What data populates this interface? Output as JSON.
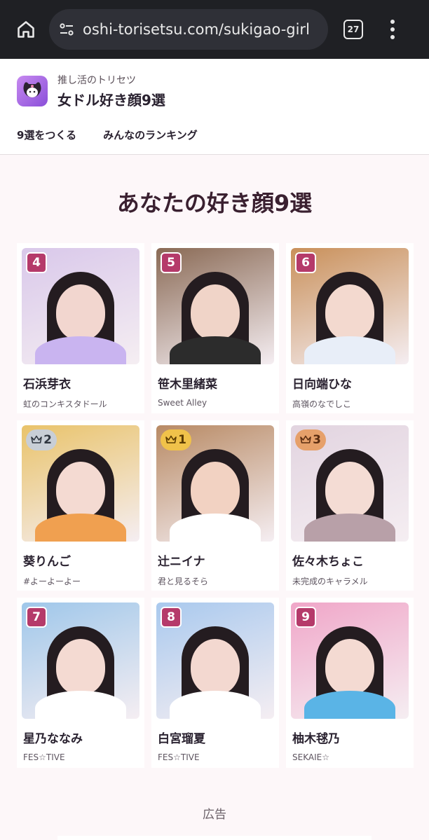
{
  "browser": {
    "url": "oshi-torisetsu.com/sukigao-girl",
    "tab_count": "27"
  },
  "site": {
    "brand_sub": "推し活のトリセツ",
    "brand_title": "女ドル好き顔9選",
    "nav": [
      "9選をつくる",
      "みんなのランキング"
    ]
  },
  "main": {
    "title": "あなたの好き顔9選",
    "cards": [
      {
        "rank": "4",
        "name": "石浜芽衣",
        "group": "虹のコンキスタドール",
        "bg": "#d9c8ea",
        "skin": "#f2d6cf",
        "accent": "#c9b4f0"
      },
      {
        "rank": "5",
        "name": "笹木里緒菜",
        "group": "Sweet Alley",
        "bg": "#8a6a55",
        "skin": "#f0d4c8",
        "accent": "#2c2c2c"
      },
      {
        "rank": "6",
        "name": "日向端ひな",
        "group": "高嶺のなでしこ",
        "bg": "#c9905a",
        "skin": "#f3d9cf",
        "accent": "#e8eef8"
      },
      {
        "rank": "2",
        "name": "葵りんご",
        "group": "#よーよーよー",
        "bg": "#e9c36a",
        "skin": "#f4dad2",
        "accent": "#f0a050",
        "crown": "silver"
      },
      {
        "rank": "1",
        "name": "辻ニイナ",
        "group": "君と見るそら",
        "bg": "#b88a64",
        "skin": "#f2d2c2",
        "accent": "#ffffff",
        "crown": "gold"
      },
      {
        "rank": "3",
        "name": "佐々木ちょこ",
        "group": "未完成のキャラメル",
        "bg": "#e2d4e0",
        "skin": "#f4dcd4",
        "accent": "#b8a0a8",
        "crown": "bronze"
      },
      {
        "rank": "7",
        "name": "星乃ななみ",
        "group": "FES☆TIVE",
        "bg": "#9fc7ea",
        "skin": "#f4dad2",
        "accent": "#ffffff"
      },
      {
        "rank": "8",
        "name": "白宮瑠夏",
        "group": "FES☆TIVE",
        "bg": "#a9c9ee",
        "skin": "#f3d8d0",
        "accent": "#ffffff"
      },
      {
        "rank": "9",
        "name": "柚木毬乃",
        "group": "SEKAIE☆",
        "bg": "#f0a6c8",
        "skin": "#f4dad2",
        "accent": "#5ab4e6"
      }
    ]
  },
  "ad": {
    "label": "広告"
  },
  "icons": {
    "home": "home-icon",
    "tune": "tune-icon",
    "tabs": "tabs-icon",
    "menu": "more-vert-icon",
    "crown": "crown-icon"
  },
  "colors": {
    "accent": "#b53a6a",
    "title": "#3a2030"
  }
}
